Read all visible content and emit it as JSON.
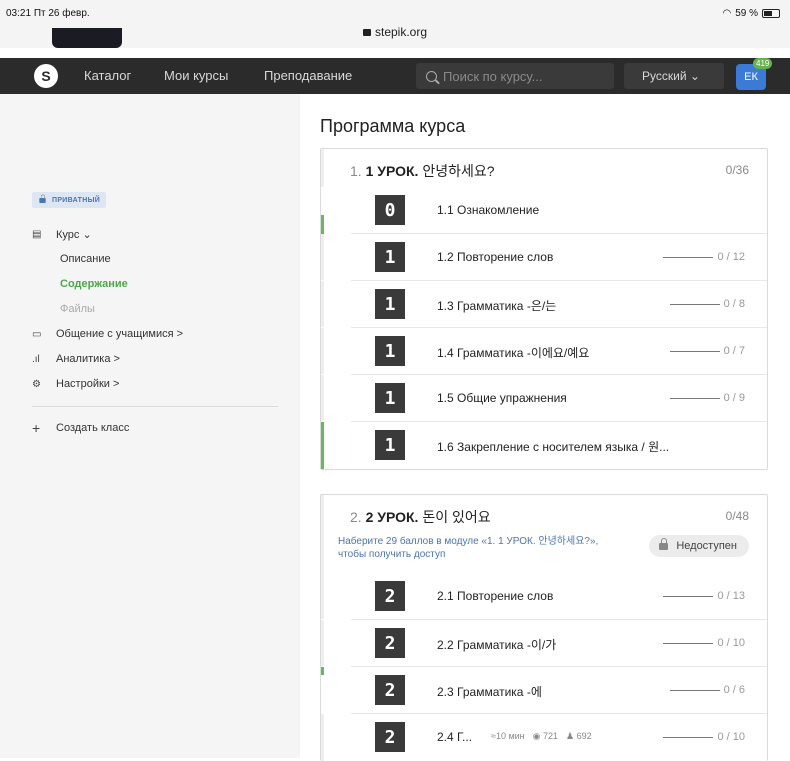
{
  "status": {
    "time": "03:21",
    "date": "Пт 26 февр.",
    "url": "stepik.org",
    "battery": "59 %",
    "battery_level": 0.59
  },
  "navbar": {
    "logo_icon": "stepik-logo-icon",
    "items": [
      "Каталог",
      "Мои курсы",
      "Преподавание"
    ],
    "search_placeholder": "Поиск по курсу...",
    "language": "Русский ⌄",
    "avatar_initials": "ЕК",
    "notifications": "419"
  },
  "sidebar": {
    "private_label": "ПРИВАТНЫЙ",
    "course_label": "Курс ⌄",
    "course_items": [
      "Описание",
      "Содержание",
      "Файлы"
    ],
    "chat_label": "Общение с учащимися >",
    "analytics_label": "Аналитика >",
    "settings_label": "Настройки >",
    "create_class_label": "Создать класс"
  },
  "main": {
    "title": "Программа курса",
    "modules": [
      {
        "number": "1.",
        "title_bold": "1 УРОК.",
        "title_rest": "안녕하세요?",
        "score": "0/36",
        "lessons": [
          {
            "icon": "0",
            "title": "1.1 Ознакомление",
            "progress": ""
          },
          {
            "icon": "1",
            "title": "1.2 Повторение слов",
            "progress": "0 / 12"
          },
          {
            "icon": "1",
            "title": "1.3 Грамматика -은/는",
            "progress": "0 / 8"
          },
          {
            "icon": "1",
            "title": "1.4 Грамматика -이에요/예요",
            "progress": "0 / 7"
          },
          {
            "icon": "1",
            "title": "1.5 Общие упражнения",
            "progress": "0 / 9"
          },
          {
            "icon": "1",
            "title": "1.6 Закрепление с носителем языка / 원...",
            "progress": ""
          }
        ]
      },
      {
        "number": "2.",
        "title_bold": "2 УРОК.",
        "title_rest": "돈이 있어요",
        "score": "0/48",
        "note": "Наберите 29 баллов в модуле «1. 1 УРОК. 안녕하세요?», чтобы получить доступ",
        "locked_label": "Недоступен",
        "lessons": [
          {
            "icon": "2",
            "title": "2.1 Повторение слов",
            "progress": "0 / 13"
          },
          {
            "icon": "2",
            "title": "2.2 Грамматика -이/가",
            "progress": "0 / 10"
          },
          {
            "icon": "2",
            "title": "2.3 Грамматика -에",
            "progress": "0 / 6"
          },
          {
            "icon": "2",
            "title": "2.4 Г...",
            "progress": "0 / 10",
            "time": "≈10 мин",
            "views": "721",
            "learners": "692"
          }
        ]
      }
    ]
  }
}
